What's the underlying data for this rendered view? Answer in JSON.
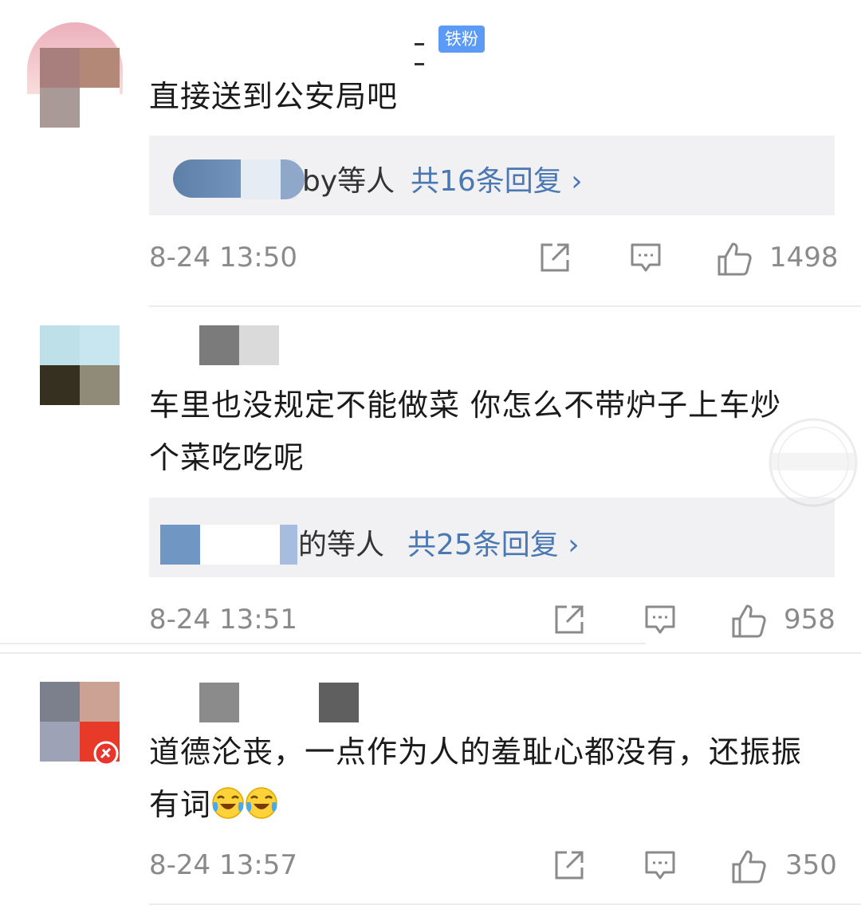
{
  "comments": [
    {
      "badge": "铁粉",
      "text": "直接送到公安局吧",
      "reply_who": "by等人",
      "reply_count": "共16条回复 ›",
      "time": "8-24 13:50",
      "likes": "1498"
    },
    {
      "text": "车里也没规定不能做菜 你怎么不带炉子上车炒个菜吃吃呢",
      "reply_who": "的等人",
      "reply_count": "共25条回复 ›",
      "time": "8-24 13:51",
      "likes": "958"
    },
    {
      "text": "道德沦丧，一点作为人的羞耻心都没有，还振振有词",
      "time": "8-24 13:57",
      "likes": "350"
    }
  ],
  "icons": {
    "share": "share-icon",
    "comment": "comment-icon",
    "like": "thumbs-up-icon",
    "emoji": "laugh-cry-emoji"
  },
  "colors": {
    "link": "#4a78b2",
    "badge": "#5b9bf5",
    "meta": "#8a8a8a"
  }
}
